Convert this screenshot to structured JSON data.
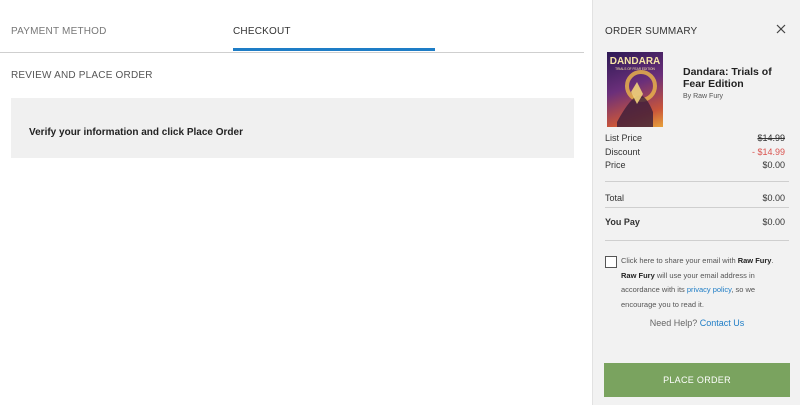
{
  "tabs": {
    "payment_method": "PAYMENT METHOD",
    "checkout": "CHECKOUT"
  },
  "main": {
    "section_title": "REVIEW AND PLACE ORDER",
    "verify_text": "Verify your information and click Place Order"
  },
  "summary": {
    "title": "ORDER SUMMARY",
    "product": {
      "name": "Dandara: Trials of Fear Edition",
      "by": "By Raw Fury",
      "cover_title": "DANDARA",
      "cover_subtitle": "TRIALS OF FEAR EDITION"
    },
    "lines": {
      "list_price_label": "List Price",
      "list_price_value": "$14.99",
      "discount_label": "Discount",
      "discount_value": "- $14.99",
      "price_label": "Price",
      "price_value": "$0.00",
      "total_label": "Total",
      "total_value": "$0.00",
      "you_pay_label": "You Pay",
      "you_pay_value": "$0.00"
    },
    "consent": {
      "part1": "Click here to share your email with ",
      "brand1": "Raw Fury",
      "part2": ". ",
      "brand2": "Raw Fury",
      "part3": " will use your email address in accordance with its ",
      "privacy_link": "privacy policy",
      "part4": ", so we encourage you to read it."
    },
    "help": {
      "prefix": "Need Help? ",
      "link": "Contact Us"
    },
    "place_order": "PLACE ORDER"
  },
  "colors": {
    "accent_blue": "#1e7dc6",
    "button_green": "#7aa35f",
    "discount_red": "#d9534f"
  }
}
